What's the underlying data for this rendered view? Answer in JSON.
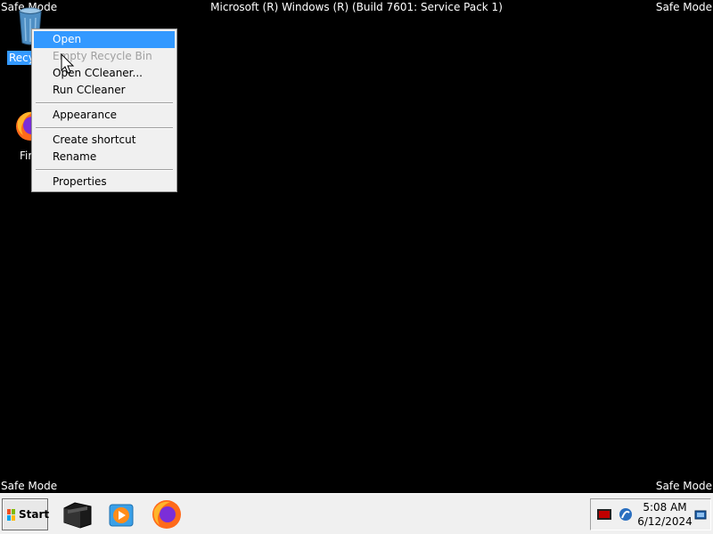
{
  "desktop": {
    "safe_mode_label": "Safe Mode",
    "build_text": "Microsoft (R) Windows (R) (Build 7601: Service Pack 1)",
    "icons": {
      "recycle_bin_label": "Recycle Bin",
      "recycle_bin_visible": "Recy",
      "firefox_label": "Firefox",
      "firefox_visible": "Fir"
    }
  },
  "context_menu": {
    "items": [
      {
        "label": "Open",
        "state": "selected"
      },
      {
        "label": "Empty Recycle Bin",
        "state": "disabled"
      },
      {
        "label": "Open CCleaner...",
        "state": "normal"
      },
      {
        "label": "Run CCleaner",
        "state": "normal"
      },
      {
        "label": "Appearance",
        "state": "normal"
      },
      {
        "label": "Create shortcut",
        "state": "normal"
      },
      {
        "label": "Rename",
        "state": "normal"
      },
      {
        "label": "Properties",
        "state": "normal"
      }
    ]
  },
  "taskbar": {
    "start_label": "Start",
    "apps": [
      {
        "name": "windows-explorer",
        "icon": "folder-icon"
      },
      {
        "name": "windows-media-player",
        "icon": "media-player-icon"
      },
      {
        "name": "firefox",
        "icon": "firefox-icon"
      }
    ],
    "tray": {
      "time": "5:08 AM",
      "date": "6/12/2024"
    }
  },
  "colors": {
    "selection": "#3399ff",
    "desktop_background": "#000000",
    "taskbar": "#f0f0f0",
    "menu_background": "#f0f0f0",
    "disabled_text": "#a0a0a0"
  }
}
